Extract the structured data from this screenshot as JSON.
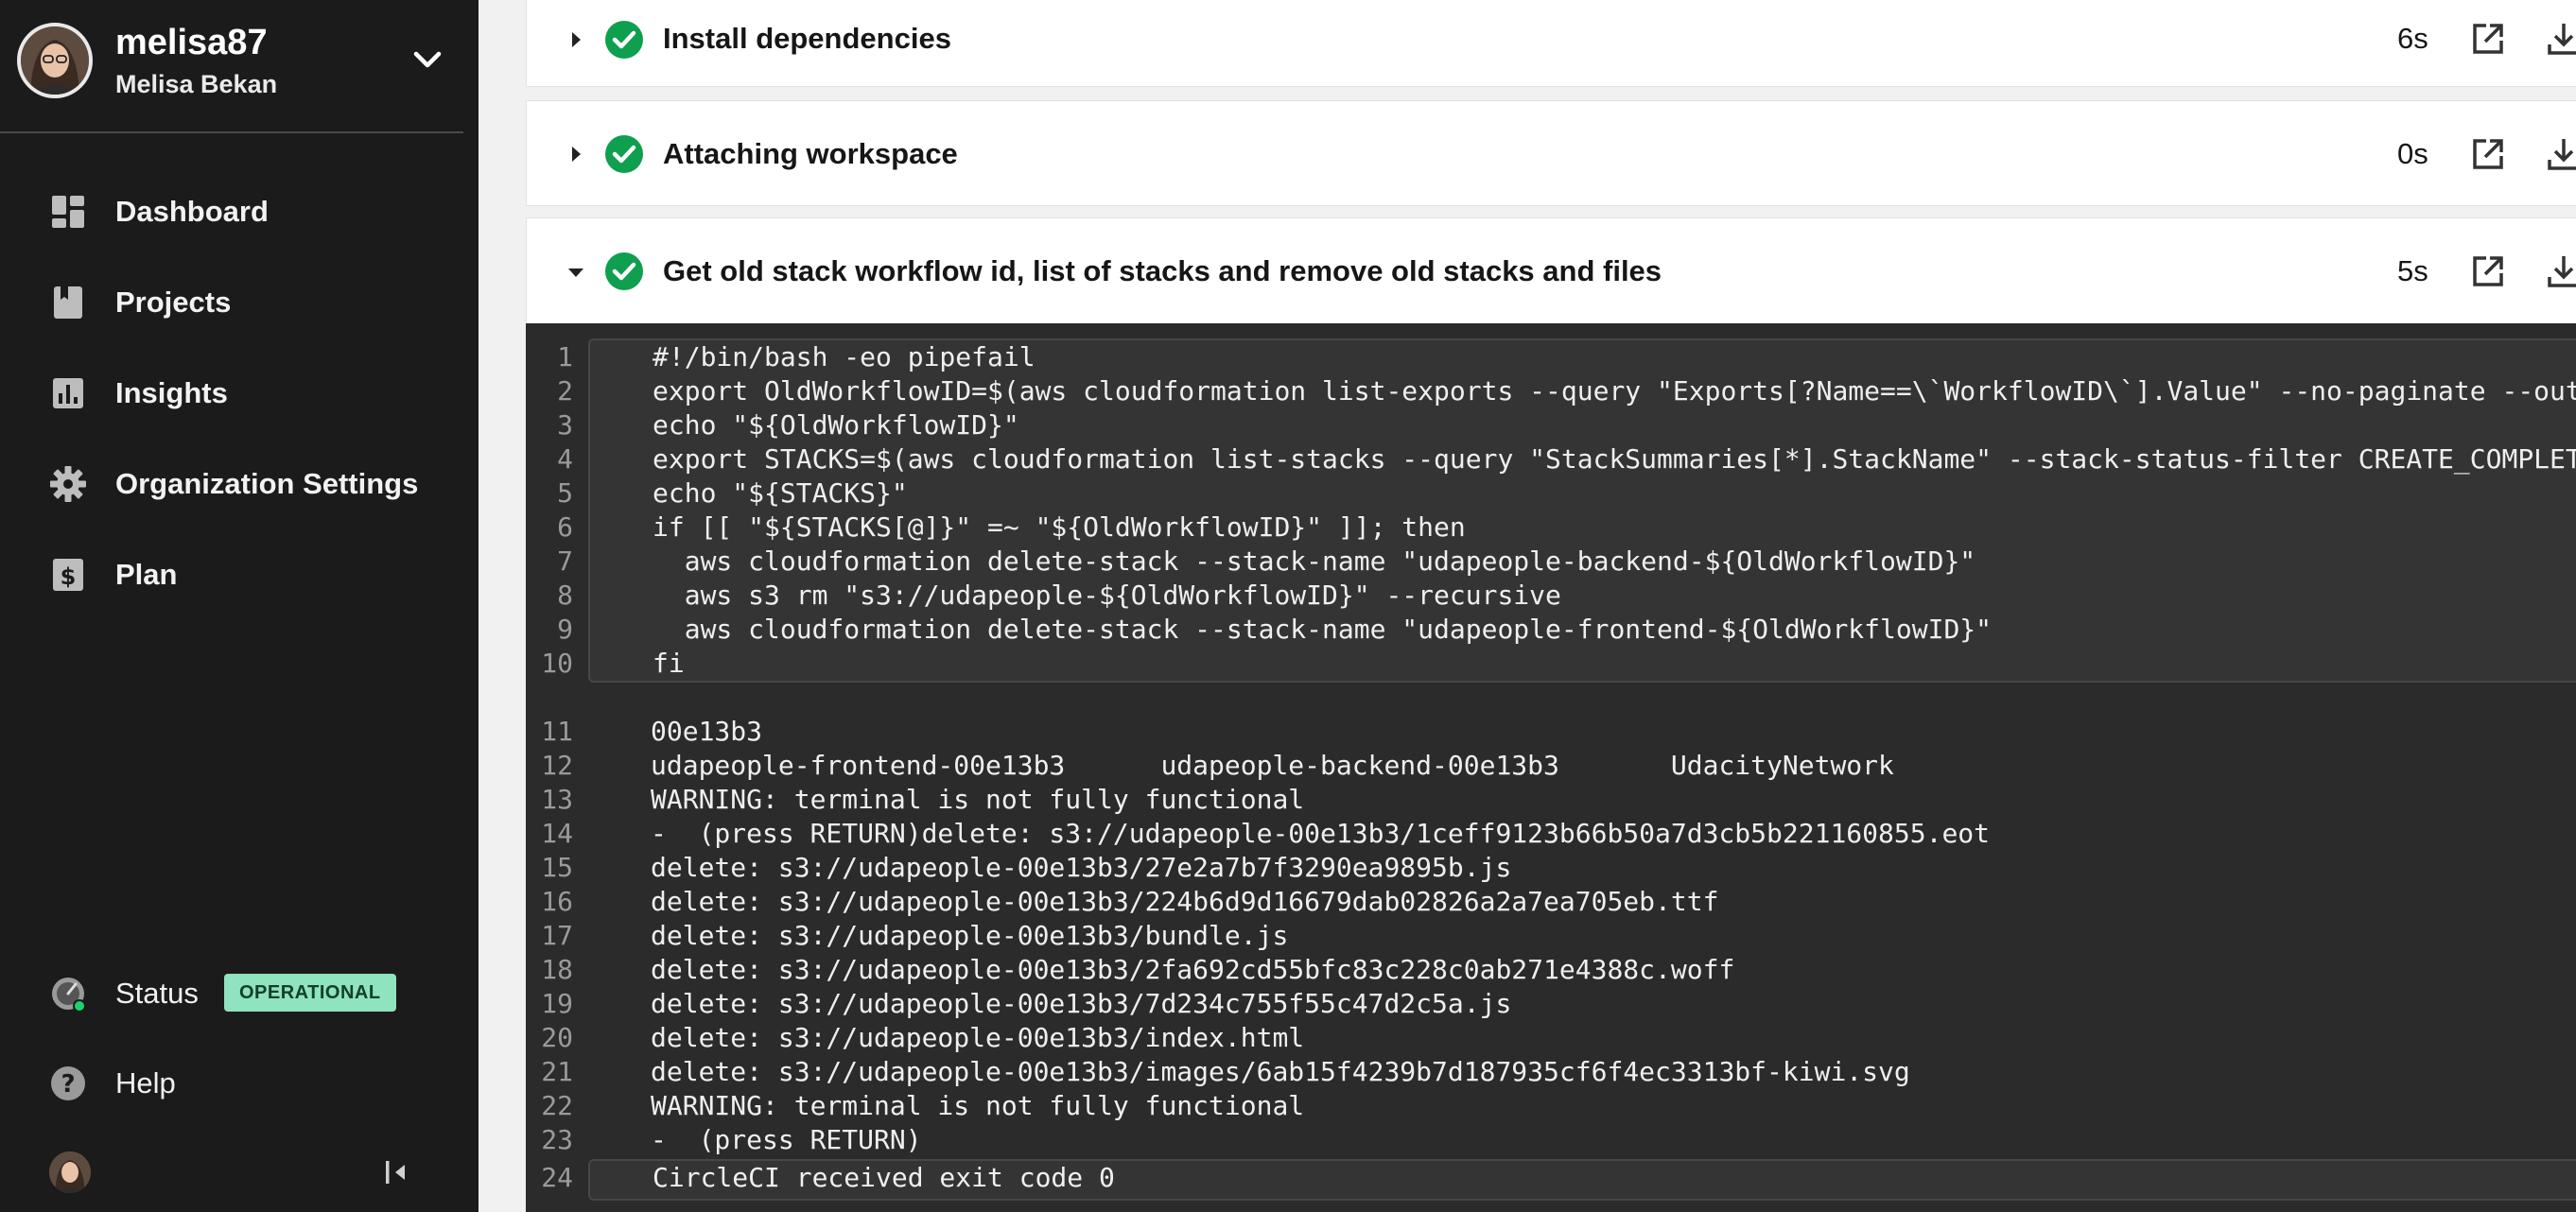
{
  "user": {
    "username": "melisa87",
    "full_name": "Melisa Bekan"
  },
  "nav": {
    "items": [
      {
        "label": "Dashboard",
        "icon": "dashboard-icon"
      },
      {
        "label": "Projects",
        "icon": "projects-icon"
      },
      {
        "label": "Insights",
        "icon": "insights-icon"
      },
      {
        "label": "Organization Settings",
        "icon": "gear-icon"
      },
      {
        "label": "Plan",
        "icon": "plan-icon"
      }
    ],
    "status_label": "Status",
    "status_badge": "OPERATIONAL",
    "help_label": "Help"
  },
  "colors": {
    "sidebar_bg": "#1b1b1b",
    "success_green": "#0e9f4f",
    "status_badge_bg": "#8fe3bd",
    "terminal_bg": "#2b2b2b"
  },
  "steps": [
    {
      "title": "Install dependencies",
      "duration": "6s",
      "expanded": false
    },
    {
      "title": "Attaching workspace",
      "duration": "0s",
      "expanded": false
    },
    {
      "title": "Get old stack workflow id, list of stacks and remove old stacks and files",
      "duration": "5s",
      "expanded": true
    }
  ],
  "terminal": {
    "lines": [
      {
        "n": "1",
        "text": "#!/bin/bash -eo pipefail"
      },
      {
        "n": "2",
        "text": "export OldWorkflowID=$(aws cloudformation list-exports --query \"Exports[?Name==\\`WorkflowID\\`].Value\" --no-paginate --output text)"
      },
      {
        "n": "3",
        "text": "echo \"${OldWorkflowID}\""
      },
      {
        "n": "4",
        "text": "export STACKS=$(aws cloudformation list-stacks --query \"StackSummaries[*].StackName\" --stack-status-filter CREATE_COMPLETE --no-paginate --output text)"
      },
      {
        "n": "5",
        "text": "echo \"${STACKS}\""
      },
      {
        "n": "6",
        "text": "if [[ \"${STACKS[@]}\" =~ \"${OldWorkflowID}\" ]]; then"
      },
      {
        "n": "7",
        "text": "  aws cloudformation delete-stack --stack-name \"udapeople-backend-${OldWorkflowID}\""
      },
      {
        "n": "8",
        "text": "  aws s3 rm \"s3://udapeople-${OldWorkflowID}\" --recursive"
      },
      {
        "n": "9",
        "text": "  aws cloudformation delete-stack --stack-name \"udapeople-frontend-${OldWorkflowID}\""
      },
      {
        "n": "10",
        "text": "fi"
      },
      {
        "n": "11",
        "text": "00e13b3"
      },
      {
        "n": "12",
        "text": "udapeople-frontend-00e13b3      udapeople-backend-00e13b3       UdacityNetwork"
      },
      {
        "n": "13",
        "text": "WARNING: terminal is not fully functional"
      },
      {
        "n": "14",
        "text": "-  (press RETURN)delete: s3://udapeople-00e13b3/1ceff9123b66b50a7d3cb5b221160855.eot"
      },
      {
        "n": "15",
        "text": "delete: s3://udapeople-00e13b3/27e2a7b7f3290ea9895b.js"
      },
      {
        "n": "16",
        "text": "delete: s3://udapeople-00e13b3/224b6d9d16679dab02826a2a7ea705eb.ttf"
      },
      {
        "n": "17",
        "text": "delete: s3://udapeople-00e13b3/bundle.js"
      },
      {
        "n": "18",
        "text": "delete: s3://udapeople-00e13b3/2fa692cd55bfc83c228c0ab271e4388c.woff"
      },
      {
        "n": "19",
        "text": "delete: s3://udapeople-00e13b3/7d234c755f55c47d2c5a.js"
      },
      {
        "n": "20",
        "text": "delete: s3://udapeople-00e13b3/index.html"
      },
      {
        "n": "21",
        "text": "delete: s3://udapeople-00e13b3/images/6ab15f4239b7d187935cf6f4ec3313bf-kiwi.svg"
      },
      {
        "n": "22",
        "text": "WARNING: terminal is not fully functional"
      },
      {
        "n": "23",
        "text": "-  (press RETURN)"
      },
      {
        "n": "24",
        "text": "CircleCI received exit code 0"
      }
    ]
  }
}
